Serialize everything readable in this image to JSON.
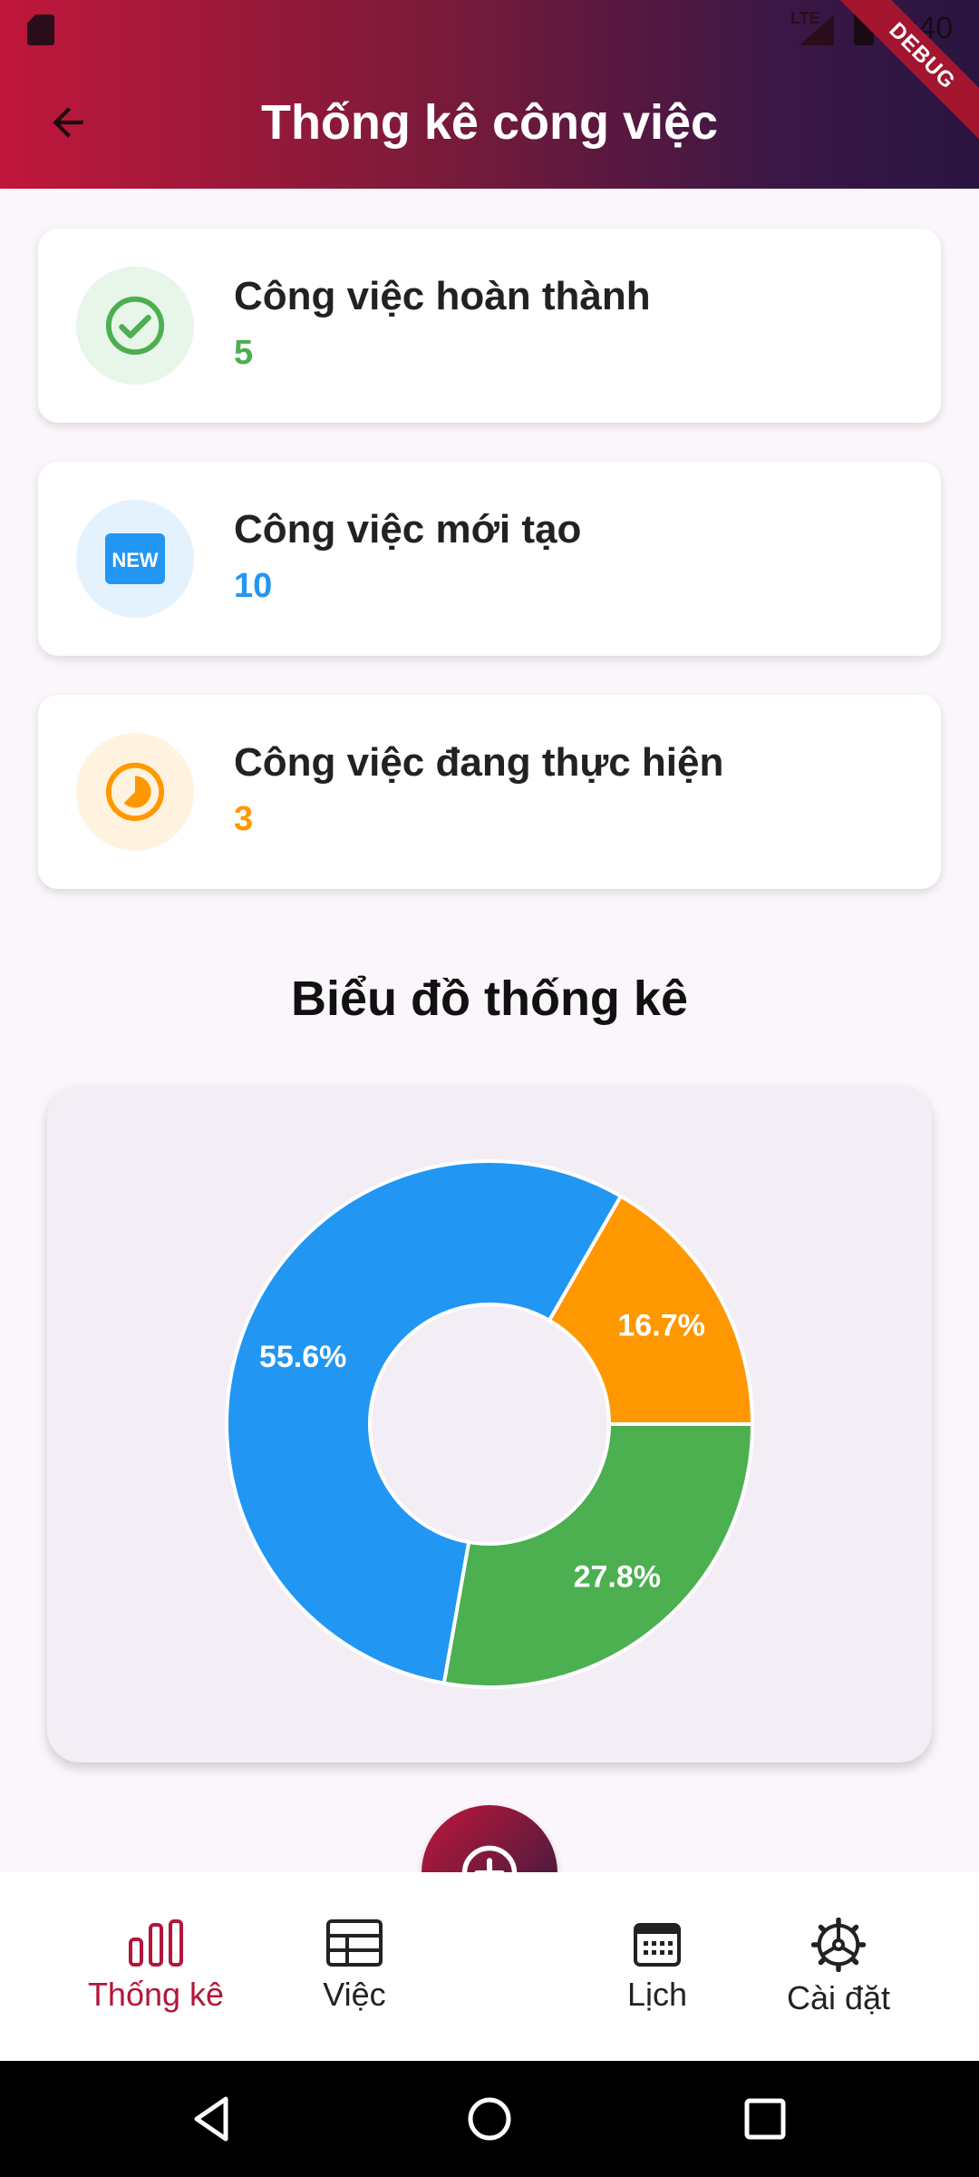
{
  "status_bar": {
    "network": "LTE",
    "time": "3:40"
  },
  "debug_banner": "DEBUG",
  "app_bar": {
    "title": "Thống kê công việc",
    "back_icon": "arrow-left-icon"
  },
  "stats": [
    {
      "label": "Công việc hoàn thành",
      "value": "5",
      "color": "#4caf50",
      "bg": "#e8f5e9",
      "icon": "check-circle-icon"
    },
    {
      "label": "Công việc mới tạo",
      "value": "10",
      "color": "#2196f3",
      "bg": "#e3f2fd",
      "icon": "new-badge-icon",
      "badge_text": "NEW"
    },
    {
      "label": "Công việc đang thực hiện",
      "value": "3",
      "color": "#ff9800",
      "bg": "#fff3e0",
      "icon": "timelapse-icon"
    }
  ],
  "chart_section": {
    "title": "Biểu đồ thống kê"
  },
  "chart_data": {
    "type": "pie",
    "donut": true,
    "title": "",
    "slices": [
      {
        "label": "16.7%",
        "value": 16.7,
        "color": "#ff9800"
      },
      {
        "label": "27.8%",
        "value": 27.8,
        "color": "#4caf50"
      },
      {
        "label": "55.6%",
        "value": 55.6,
        "color": "#2196f3"
      }
    ]
  },
  "bottom_nav": {
    "items": [
      {
        "label": "Thống kê",
        "icon": "bar-chart-icon",
        "active": true
      },
      {
        "label": "Việc",
        "icon": "table-icon",
        "active": false
      },
      {
        "label": "Lịch",
        "icon": "calendar-icon",
        "active": false
      },
      {
        "label": "Cài đặt",
        "icon": "settings-icon",
        "active": false
      }
    ],
    "fab_icon": "add-circle-icon"
  },
  "system_nav": {
    "back_icon": "triangle-back-icon",
    "home_icon": "circle-home-icon",
    "recents_icon": "square-recents-icon"
  },
  "colors": {
    "accent": "#b3163a",
    "header_start": "#c0173b",
    "header_end": "#2a1540"
  }
}
